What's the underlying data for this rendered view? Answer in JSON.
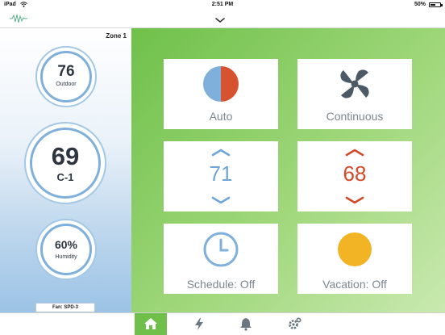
{
  "status_bar": {
    "carrier": "iPad",
    "time": "2:51 PM",
    "battery": "50%",
    "battery_level": 0.5
  },
  "header": {
    "logo_icon": "waveform-logo-icon",
    "collapse_icon": "chevron-down-icon"
  },
  "sidebar": {
    "zone": "Zone 1",
    "outdoor": {
      "value": "76",
      "label": "Outdoor"
    },
    "indoor": {
      "value": "69",
      "label": "C-1"
    },
    "humidity": {
      "value": "60%",
      "label": "Humidity"
    },
    "fan_status": "Fan: SPD-3"
  },
  "tiles": {
    "mode": {
      "label": "Auto",
      "icon": "auto-mode-icon",
      "colors": [
        "#7fb0dc",
        "#d65230"
      ]
    },
    "fan": {
      "label": "Continuous",
      "icon": "fan-icon"
    },
    "cool": {
      "value": "71",
      "color": "#6fa5d7",
      "icon_up": "chevron-up-icon",
      "icon_down": "chevron-down-icon"
    },
    "heat": {
      "value": "68",
      "color": "#d24a2a",
      "icon_up": "chevron-up-icon",
      "icon_down": "chevron-down-icon"
    },
    "schedule": {
      "label": "Schedule: Off",
      "icon": "clock-icon"
    },
    "vacation": {
      "label": "Vacation: Off",
      "icon": "sun-icon",
      "color": "#f2b424"
    }
  },
  "tabbar": {
    "tabs": [
      {
        "icon": "home-icon",
        "active": true
      },
      {
        "icon": "lightning-icon",
        "active": false
      },
      {
        "icon": "bell-icon",
        "active": false
      },
      {
        "icon": "settings-icon",
        "active": false
      }
    ]
  }
}
